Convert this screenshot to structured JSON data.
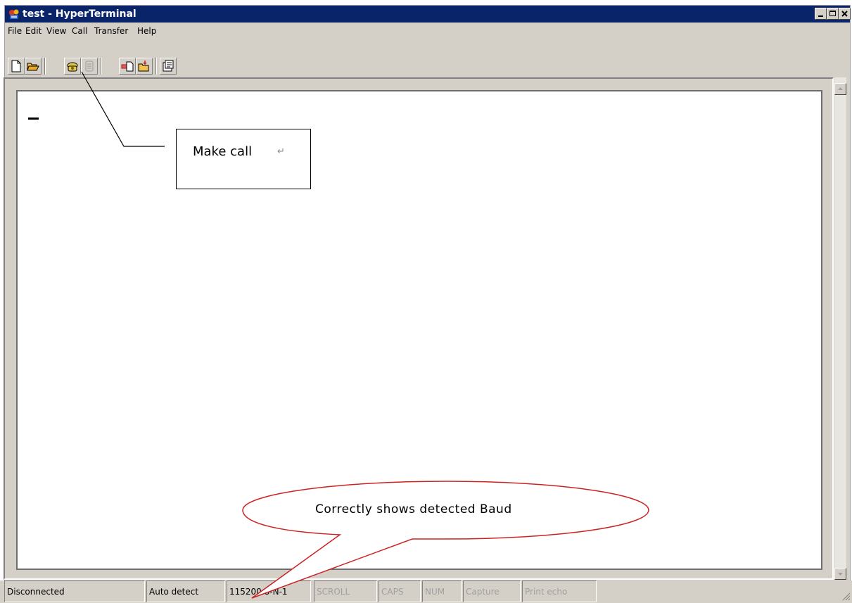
{
  "window": {
    "title": "test - HyperTerminal"
  },
  "menu": [
    "File",
    "Edit",
    "View",
    "Call",
    "Transfer",
    "Help"
  ],
  "toolbar": {
    "buttons": [
      "new-connection",
      "open",
      "call",
      "disconnect",
      "send",
      "receive",
      "properties"
    ]
  },
  "annotations": {
    "make_call": "Make call",
    "return_mark": "↵",
    "baud_note": "Correctly shows detected Baud"
  },
  "status": {
    "connection": "Disconnected",
    "detect": "Auto detect",
    "baud": "115200 8-N-1",
    "scroll": "SCROLL",
    "caps": "CAPS",
    "num": "NUM",
    "capture": "Capture",
    "print_echo": "Print echo"
  },
  "colors": {
    "titlebar": "#0a246a",
    "chrome": "#d4d0c8",
    "callout_line": "#cc2222"
  }
}
